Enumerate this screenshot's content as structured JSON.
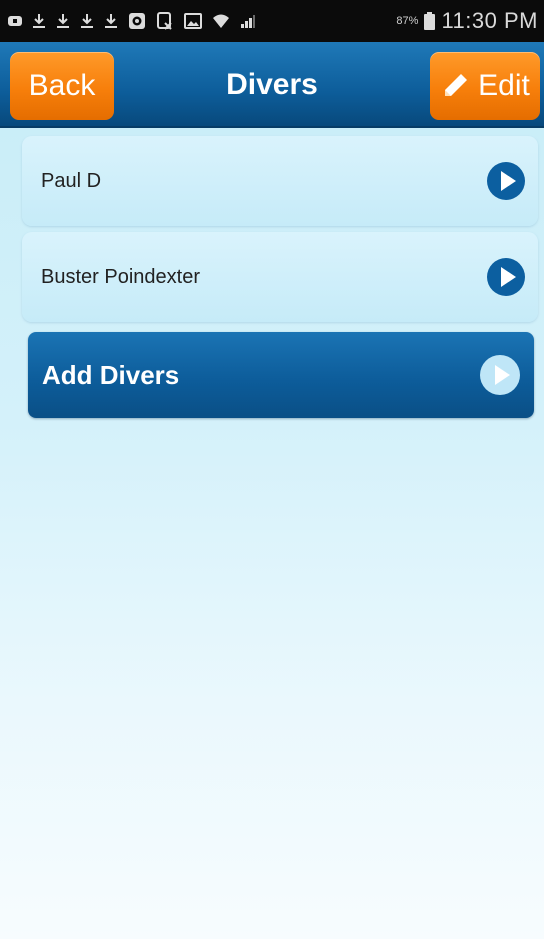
{
  "status_bar": {
    "icons": [
      "notification-icon",
      "download-icon",
      "download-icon",
      "download-icon",
      "download-icon",
      "shield-icon",
      "clipboard-icon",
      "image-icon",
      "wifi-icon",
      "signal-icon"
    ],
    "battery_percent": "87%",
    "time": "11:30 PM"
  },
  "header": {
    "title": "Divers",
    "back_label": "Back",
    "edit_label": "Edit",
    "bar_color": "#0d5d9a",
    "button_color": "#f77f0b"
  },
  "divers": [
    {
      "name": "Paul D"
    },
    {
      "name": "Buster Poindexter"
    }
  ],
  "add_button": {
    "label": "Add Divers"
  }
}
